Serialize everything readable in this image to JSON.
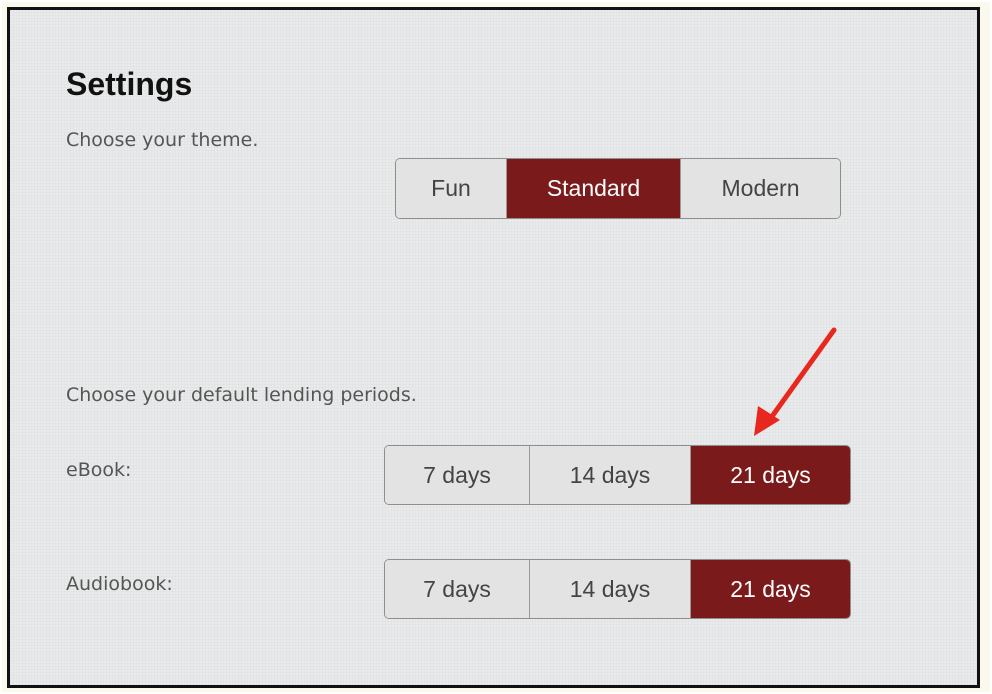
{
  "settings": {
    "title": "Settings",
    "theme_prompt": "Choose your theme.",
    "theme_options": [
      "Fun",
      "Standard",
      "Modern"
    ],
    "theme_selected": "Standard",
    "lending_prompt": "Choose your default lending periods.",
    "ebook": {
      "label": "eBook:",
      "options": [
        "7 days",
        "14 days",
        "21 days"
      ],
      "selected": "21 days"
    },
    "audiobook": {
      "label": "Audiobook:",
      "options": [
        "7 days",
        "14 days",
        "21 days"
      ],
      "selected": "21 days"
    }
  },
  "colors": {
    "selected": "#7b1a1a",
    "unselected": "#e3e3e3",
    "annotation_arrow": "#e8281f"
  },
  "icons": {
    "annotation": "red-arrow-icon"
  }
}
